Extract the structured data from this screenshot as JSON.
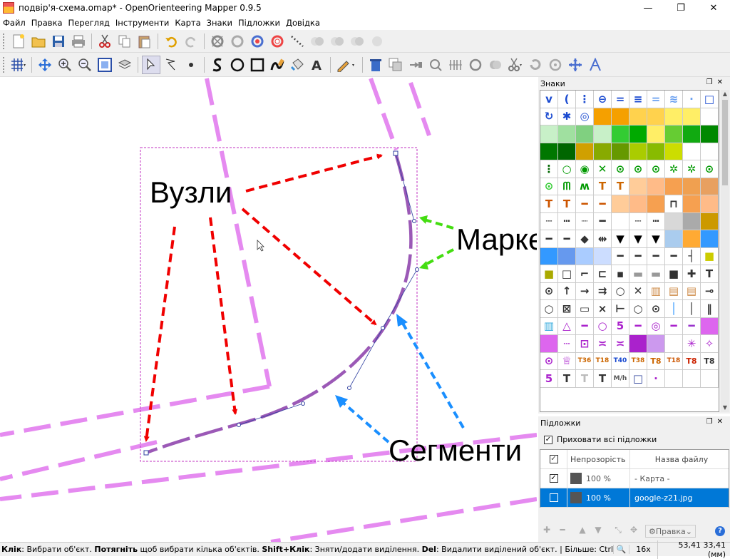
{
  "window": {
    "title": "подвір'я-схема.omap* - OpenOrienteering Mapper 0.9.5",
    "minimize": "—",
    "maximize": "❐",
    "close": "✕"
  },
  "menu": [
    {
      "label": "Файл"
    },
    {
      "label": "Правка"
    },
    {
      "label": "Перегляд"
    },
    {
      "label": "Інструменти"
    },
    {
      "label": "Карта"
    },
    {
      "label": "Знаки"
    },
    {
      "label": "Підложки"
    },
    {
      "label": "Довідка"
    }
  ],
  "annotations": {
    "nodes_label": "Вузли",
    "markers_label": "Маркери",
    "segments_label": "Сегменти",
    "nodes_color": "#f00000",
    "markers_color": "#44dd11",
    "segments_color": "#1a8fff"
  },
  "symbols_panel": {
    "title": "Знаки",
    "text_symbols": [
      "T36",
      "T18",
      "T40",
      "T38",
      "T8",
      "T18",
      "T8",
      "T8",
      "5",
      "T",
      "T",
      "M/h"
    ]
  },
  "templates_panel": {
    "title": "Підложки",
    "hide_all_label": "Приховати всі підложки",
    "hide_all_checked": "✓",
    "col_opacity": "Непрозорість",
    "col_filename": "Назва файлу",
    "rows": [
      {
        "checked": "✓",
        "opacity": "100 %",
        "name": "- Карта -"
      },
      {
        "checked": "",
        "opacity": "100 %",
        "name": "google-z21.jpg"
      }
    ],
    "edit_label": "Правка"
  },
  "statusbar": {
    "hint_parts": [
      {
        "b": "Клік",
        "t": ": Вибрати об'єкт. "
      },
      {
        "b": "Потягніть",
        "t": " щоб вибрати кілька об'єктів. "
      },
      {
        "b": "Shift+Клік",
        "t": ": Зняти/додати виділення. "
      },
      {
        "b": "Del",
        "t": ": Видалити виділений об'єкт. | Більше: Ctrl, Пропуск"
      }
    ],
    "zoom": "16x",
    "coords": "53,41 33,41 (мм)"
  }
}
